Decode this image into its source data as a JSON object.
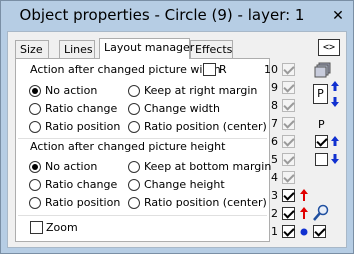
{
  "window": {
    "title": "Object properties - Circle (9) - layer: 1"
  },
  "tabs": [
    "Size",
    "Lines",
    "Layout manager",
    "Effects"
  ],
  "width_section": {
    "label": "Action after changed picture width",
    "r_checkbox_label": "R",
    "options": [
      "No action",
      "Keep at right margin",
      "Ratio change",
      "Change width",
      "Ratio position",
      "Ratio position (center)"
    ],
    "selected": "No action"
  },
  "height_section": {
    "label": "Action after changed picture height",
    "options": [
      "No action",
      "Keep at bottom margin",
      "Ratio change",
      "Change height",
      "Ratio position",
      "Ratio position (center)"
    ],
    "selected": "No action"
  },
  "zoom": {
    "label": "Zoom",
    "checked": false
  },
  "nav_button": {
    "label": "<>"
  },
  "layers": [
    {
      "num": "10",
      "checked": true,
      "enabled": false
    },
    {
      "num": "9",
      "checked": true,
      "enabled": false
    },
    {
      "num": "8",
      "checked": true,
      "enabled": false
    },
    {
      "num": "7",
      "checked": true,
      "enabled": false
    },
    {
      "num": "6",
      "checked": true,
      "enabled": false
    },
    {
      "num": "5",
      "checked": true,
      "enabled": false
    },
    {
      "num": "4",
      "checked": true,
      "enabled": false
    },
    {
      "num": "3",
      "checked": true,
      "enabled": true
    },
    {
      "num": "2",
      "checked": true,
      "enabled": true
    },
    {
      "num": "1",
      "checked": true,
      "enabled": true
    }
  ],
  "side_labels": {
    "p_button": "P",
    "p_label": "P"
  },
  "colors": {
    "titlebar": "#b6cde4",
    "red_arrow": "#e00000",
    "blue": "#1030d0"
  }
}
